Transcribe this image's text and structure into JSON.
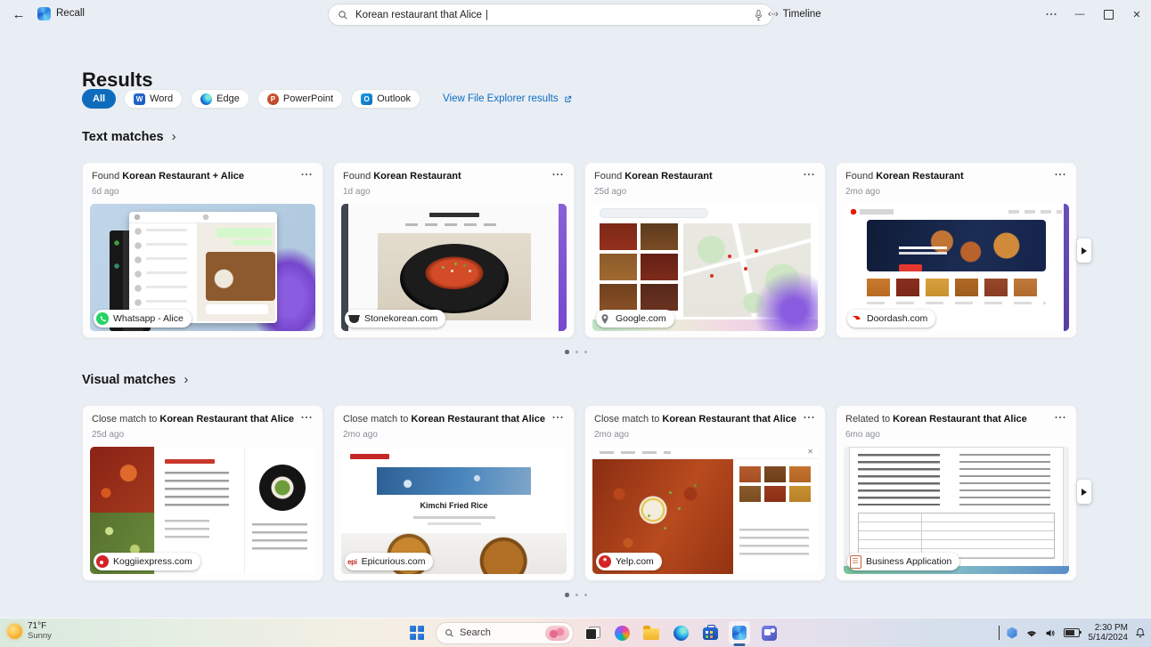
{
  "titlebar": {
    "app_title": "Recall",
    "search_value": "Korean restaurant that Alice",
    "timeline_label": "Timeline"
  },
  "icons": {
    "back": "←",
    "timeline_glyph": "‹··›",
    "minimize": "—",
    "close": "✕",
    "chevron_right": "›",
    "word_letter": "W",
    "powerpoint_letter": "P",
    "outlook_letter": "O",
    "epicurious_logo": "epi",
    "yelp_star": "*",
    "caret": "|"
  },
  "results": {
    "heading": "Results",
    "filters": [
      {
        "label": "All",
        "active": true
      },
      {
        "label": "Word"
      },
      {
        "label": "Edge"
      },
      {
        "label": "PowerPoint"
      },
      {
        "label": "Outlook"
      }
    ],
    "file_explorer_link": "View File Explorer results"
  },
  "sections": [
    {
      "title": "Text matches",
      "cards": [
        {
          "prefix": "Found",
          "match": "Korean Restaurant + Alice",
          "time": "6d ago",
          "badge": "Whatsapp - Alice"
        },
        {
          "prefix": "Found",
          "match": "Korean Restaurant",
          "time": "1d ago",
          "badge": "Stonekorean.com"
        },
        {
          "prefix": "Found",
          "match": "Korean Restaurant",
          "time": "25d ago",
          "badge": "Google.com"
        },
        {
          "prefix": "Found",
          "match": "Korean Restaurant",
          "time": "2mo ago",
          "badge": "Doordash.com"
        }
      ]
    },
    {
      "title": "Visual matches",
      "cards": [
        {
          "prefix": "Close match to",
          "match": "Korean Restaurant that Alice",
          "time": "25d ago",
          "badge": "Koggiiexpress.com"
        },
        {
          "prefix": "Close match to",
          "match": "Korean Restaurant that Alice",
          "time": "2mo ago",
          "badge": "Epicurious.com",
          "thumb_title": "Kimchi Fried Rice"
        },
        {
          "prefix": "Close match to",
          "match": "Korean Restaurant that Alice",
          "time": "2mo ago",
          "badge": "Yelp.com"
        },
        {
          "prefix": "Related to",
          "match": "Korean Restaurant that Alice",
          "time": "6mo ago",
          "badge": "Business Application"
        }
      ]
    }
  ],
  "colors": {
    "accent": "#0f6cbd"
  },
  "taskbar": {
    "weather_temp": "71°F",
    "weather_condition": "Sunny",
    "search_label": "Search",
    "time": "2:30 PM",
    "date": "5/14/2024"
  }
}
